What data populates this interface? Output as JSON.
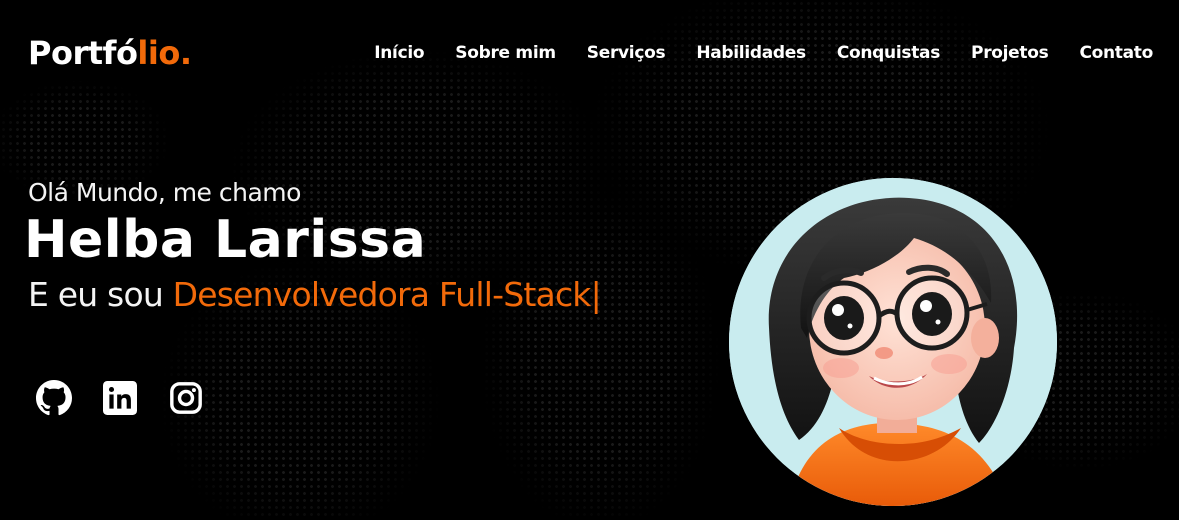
{
  "logo": {
    "main": "Portfó",
    "accent": "lio."
  },
  "nav": [
    {
      "label": "Início"
    },
    {
      "label": "Sobre mim"
    },
    {
      "label": "Serviços"
    },
    {
      "label": "Habilidades"
    },
    {
      "label": "Conquistas"
    },
    {
      "label": "Projetos"
    },
    {
      "label": "Contato"
    }
  ],
  "hero": {
    "greeting": "Olá Mundo, me chamo",
    "name": "Helba Larissa",
    "role_prefix": "E eu sou ",
    "role_typed": "Desenvolvedora Full-Stack",
    "cursor": "|"
  },
  "socials": [
    {
      "icon": "github-icon"
    },
    {
      "icon": "linkedin-icon"
    },
    {
      "icon": "instagram-icon"
    }
  ],
  "colors": {
    "accent": "#f26a0a",
    "background": "#000000",
    "text": "#ffffff",
    "avatar_bg": "#c9ecef"
  }
}
